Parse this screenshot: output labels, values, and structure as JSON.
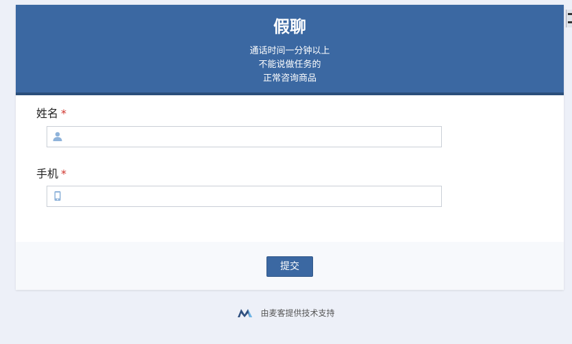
{
  "form": {
    "title": "假聊",
    "description": [
      "通话时间一分钟以上",
      "不能说做任务的",
      "正常咨询商品"
    ],
    "fields": [
      {
        "label": "姓名",
        "required_mark": "*",
        "icon": "user-icon",
        "value": "",
        "placeholder": ""
      },
      {
        "label": "手机",
        "required_mark": "*",
        "icon": "mobile-phone-icon",
        "value": "",
        "placeholder": ""
      }
    ],
    "submit_label": "提交"
  },
  "footer": {
    "logo_icon": "maike-logo-icon",
    "text": "由麦客提供技术支持"
  },
  "colors": {
    "header_bg": "#3b68a2",
    "header_border": "#2a4e7a",
    "page_bg": "#edf0f8",
    "required": "#d0342c",
    "icon": "#8fb3da"
  }
}
